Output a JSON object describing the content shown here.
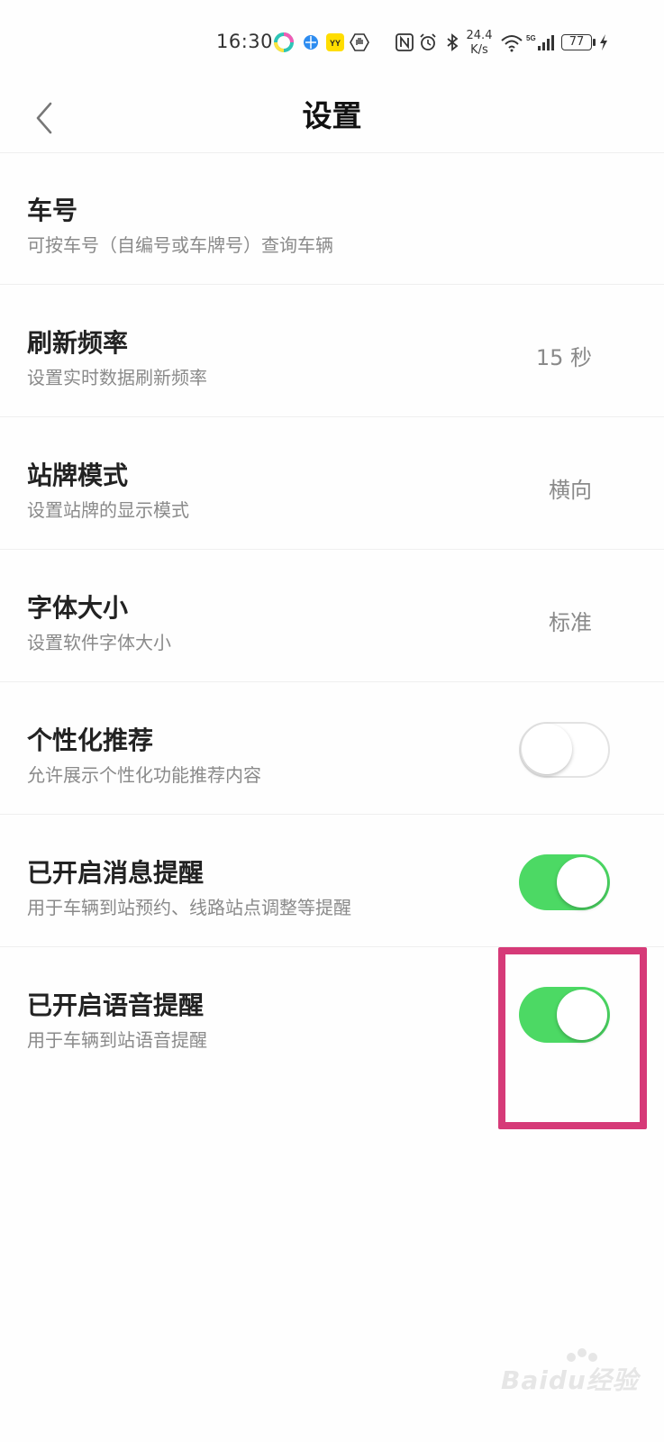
{
  "status_bar": {
    "time": "16:30",
    "net_speed_value": "24.4",
    "net_speed_unit": "K/s",
    "network_type": "5G",
    "battery": "77"
  },
  "header": {
    "title": "设置"
  },
  "settings": [
    {
      "title": "车号",
      "desc": "可按车号（自编号或车牌号）查询车辆"
    },
    {
      "title": "刷新频率",
      "desc": "设置实时数据刷新频率",
      "value": "15 秒"
    },
    {
      "title": "站牌模式",
      "desc": "设置站牌的显示模式",
      "value": "横向"
    },
    {
      "title": "字体大小",
      "desc": "设置软件字体大小",
      "value": "标准"
    },
    {
      "title": "个性化推荐",
      "desc": "允许展示个性化功能推荐内容",
      "toggle": "off"
    },
    {
      "title": "已开启消息提醒",
      "desc": "用于车辆到站预约、线路站点调整等提醒",
      "toggle": "on"
    },
    {
      "title": "已开启语音提醒",
      "desc": "用于车辆到站语音提醒",
      "toggle": "on"
    }
  ],
  "colors": {
    "toggle_on": "#4cd964",
    "highlight": "#d63a78"
  },
  "watermark": {
    "text": "Baidu经验"
  }
}
